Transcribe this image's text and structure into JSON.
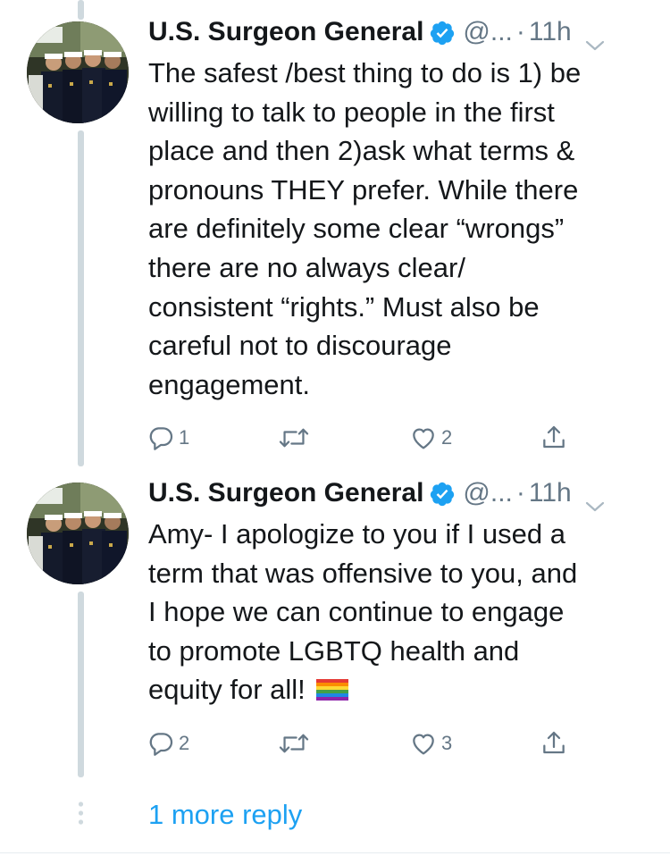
{
  "colors": {
    "accent": "#1da1f2",
    "secondary_text": "#657786",
    "primary_text": "#14171a",
    "thread_line": "#cfd9de"
  },
  "tweets": [
    {
      "display_name": "U.S. Surgeon General",
      "verified_icon": "verified-badge-icon",
      "handle": "@...",
      "separator": "·",
      "time": "11h",
      "text": "The safest /best thing to do is 1) be\nwilling to talk to people in the first\nplace and then 2)ask what terms &\npronouns THEY prefer. While there\nare definitely some clear “wrongs”\nthere are no always clear/\nconsistent “rights.” Must also be\ncareful not to discourage\nengagement.",
      "emoji": "",
      "actions": {
        "reply_count": "1",
        "retweet_count": "",
        "like_count": "2"
      }
    },
    {
      "display_name": "U.S. Surgeon General",
      "verified_icon": "verified-badge-icon",
      "handle": "@...",
      "separator": "·",
      "time": "11h",
      "text": "Amy- I apologize to you if I used a\nterm that was offensive to you, and\nI hope we can continue to engage\nto promote LGBTQ health and\nequity for all!",
      "emoji": "rainbow-flag-emoji",
      "actions": {
        "reply_count": "2",
        "retweet_count": "",
        "like_count": "3"
      }
    }
  ],
  "more_replies_label": "1 more reply"
}
